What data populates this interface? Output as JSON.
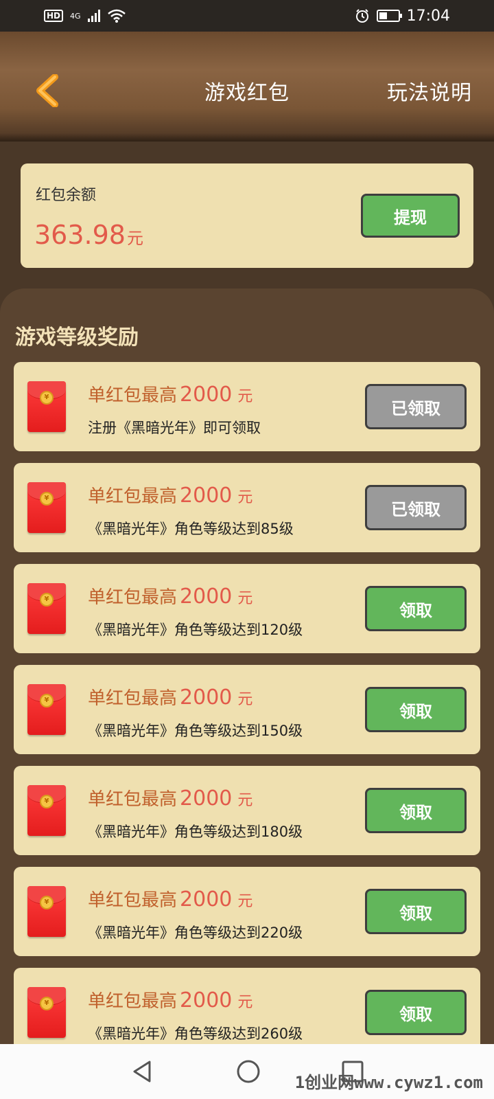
{
  "status_bar": {
    "hd": "HD",
    "network": "4G",
    "time": "17:04"
  },
  "header": {
    "title": "游戏红包",
    "rules": "玩法说明"
  },
  "balance": {
    "label": "红包余额",
    "amount": "363.98",
    "unit": "元",
    "withdraw_label": "提现"
  },
  "rewards": {
    "title": "游戏等级奖励",
    "items": [
      {
        "prefix": "单红包最高",
        "amount": "2000",
        "unit": "元",
        "condition": "注册《黑暗光年》即可领取",
        "button": "已领取",
        "state": "claimed"
      },
      {
        "prefix": "单红包最高",
        "amount": "2000",
        "unit": "元",
        "condition": "《黑暗光年》角色等级达到85级",
        "button": "已领取",
        "state": "claimed"
      },
      {
        "prefix": "单红包最高",
        "amount": "2000",
        "unit": "元",
        "condition": "《黑暗光年》角色等级达到120级",
        "button": "领取",
        "state": "available"
      },
      {
        "prefix": "单红包最高",
        "amount": "2000",
        "unit": "元",
        "condition": "《黑暗光年》角色等级达到150级",
        "button": "领取",
        "state": "available"
      },
      {
        "prefix": "单红包最高",
        "amount": "2000",
        "unit": "元",
        "condition": "《黑暗光年》角色等级达到180级",
        "button": "领取",
        "state": "available"
      },
      {
        "prefix": "单红包最高",
        "amount": "2000",
        "unit": "元",
        "condition": "《黑暗光年》角色等级达到220级",
        "button": "领取",
        "state": "available"
      },
      {
        "prefix": "单红包最高",
        "amount": "2000",
        "unit": "元",
        "condition": "《黑暗光年》角色等级达到260级",
        "button": "领取",
        "state": "available"
      }
    ]
  },
  "watermark": "1创业网www.cywz1.com",
  "colors": {
    "accent_red": "#e25a4a",
    "claim_green": "#62b65b",
    "claimed_gray": "#9a9a9a",
    "card_bg": "#efe0b0"
  }
}
